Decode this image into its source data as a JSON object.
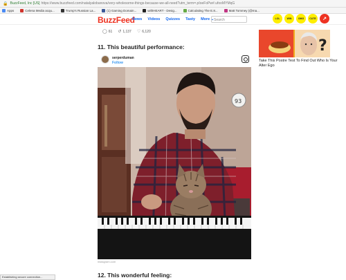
{
  "browser": {
    "secure_label": "BuzzFeed, Inc [US]",
    "url": "https://www.buzzfeed.com/natalyalobanova/very-wholesome-things-because-we-all-need?utm_term=.pIoeFoPw#.ufooMYMqG",
    "bookmarks": [
      {
        "label": "Apps",
        "color": "#4a8af4"
      },
      {
        "label": "Celena Media acqu...",
        "color": "#d0342c"
      },
      {
        "label": "Trump's Russian La...",
        "color": "#333333"
      },
      {
        "label": "(1) Gaming Domain...",
        "color": "#3b5998"
      },
      {
        "label": "withHEART - Desig...",
        "color": "#222222"
      },
      {
        "label": "Calculating The E.8...",
        "color": "#6a4"
      },
      {
        "label": "Matt Tommey (@ma...",
        "color": "#c13584"
      }
    ],
    "status_text": "Establishing secure connection..."
  },
  "header": {
    "logo": "BuzzFeed",
    "nav": [
      "News",
      "Videos",
      "Quizzes",
      "Tasty",
      "More ⌄"
    ],
    "search_placeholder": "Search",
    "badges": [
      "LOL",
      "WIN",
      "OMG",
      "CUTE"
    ],
    "trending_icon": "trending-icon"
  },
  "social": {
    "comments": "61",
    "retweets": "1,137",
    "likes": "6,120"
  },
  "article": {
    "item_title": "11. This beautiful performance:",
    "next_title": "12. This wonderful feeling:",
    "instagram": {
      "username": "serperduman",
      "follow_label": "Follow",
      "credit": "instagram.com"
    }
  },
  "sidebar_ad": {
    "caption": "Take This Postre Test To Find Out Who Is Your Alter Ego"
  },
  "colors": {
    "brand": "#ee3322",
    "link": "#0f65ef",
    "badge": "#ffee00"
  }
}
